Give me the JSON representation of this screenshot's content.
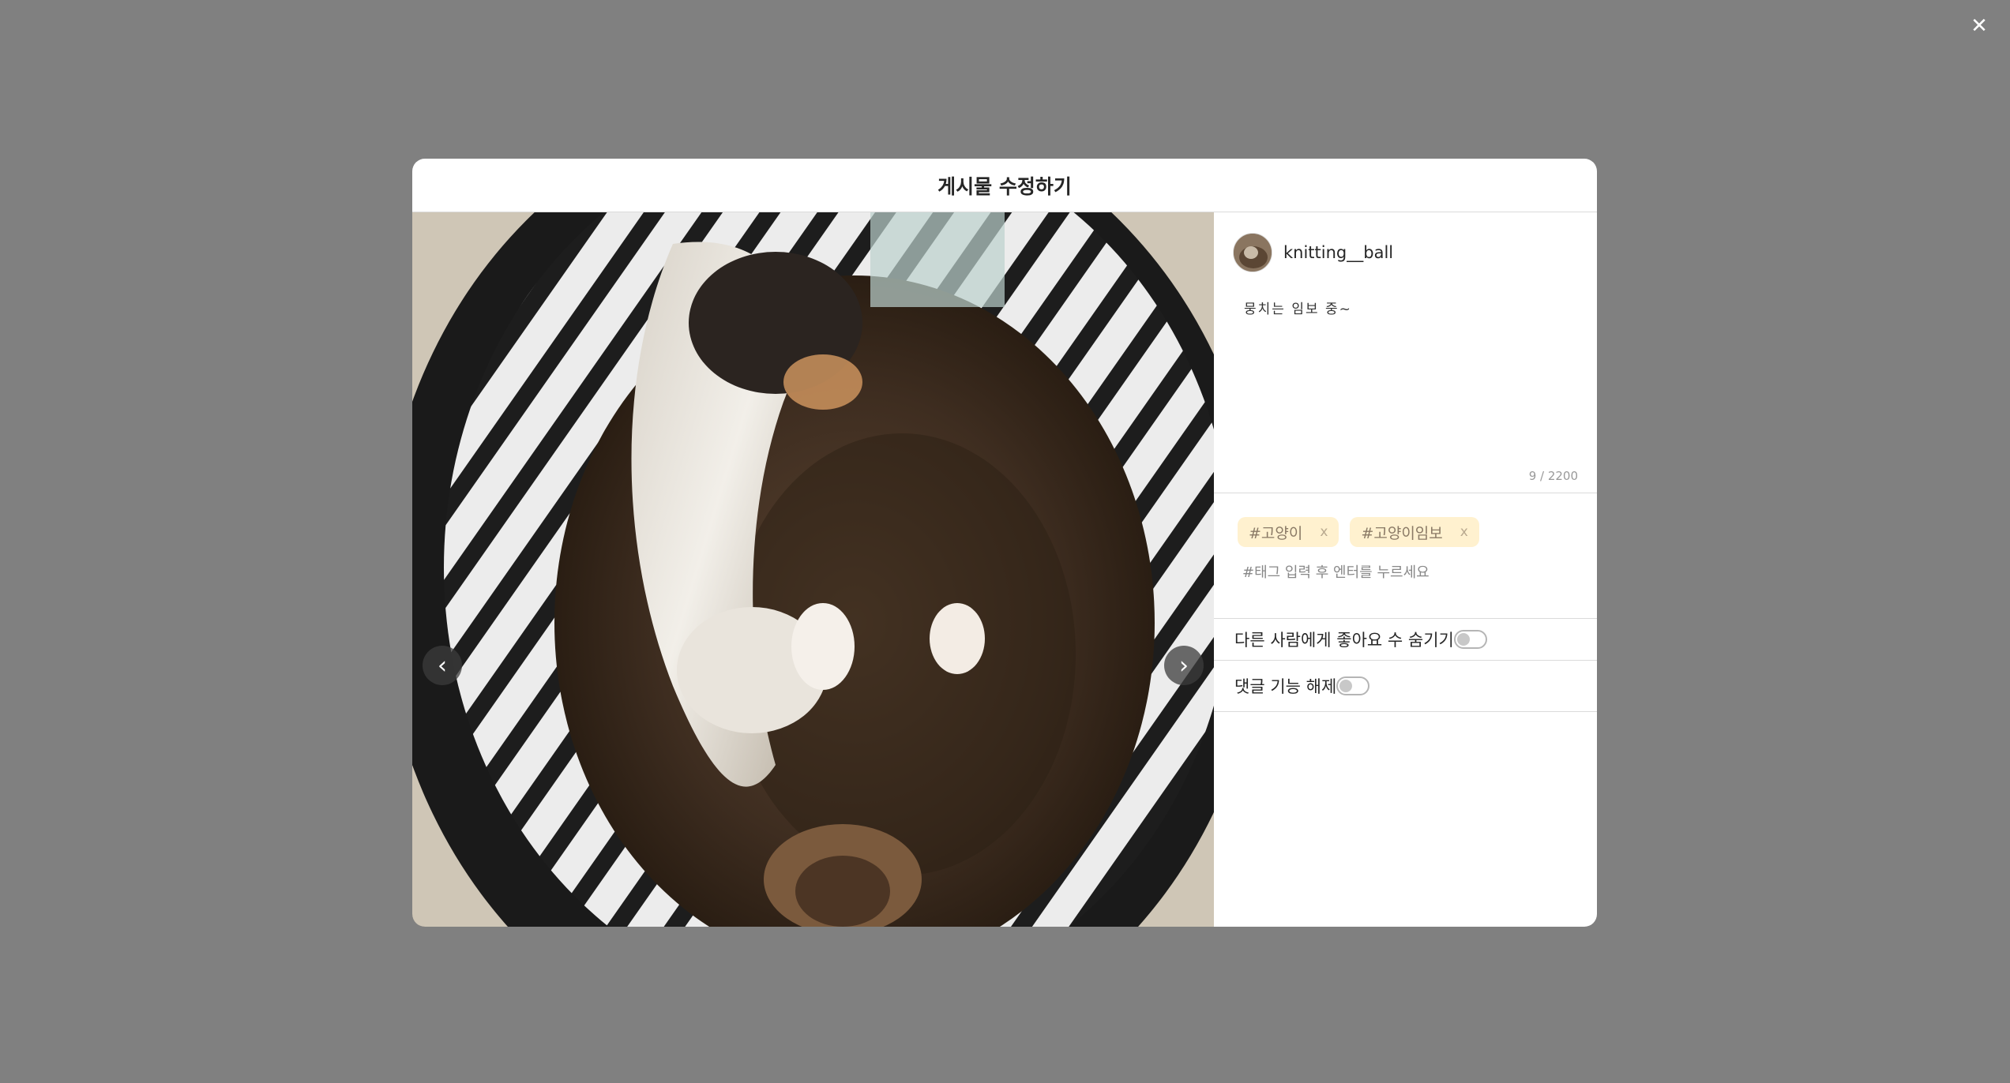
{
  "dialog": {
    "title": "게시물 수정하기",
    "close_glyph": "✕"
  },
  "photo": {
    "prev_glyph": "‹",
    "next_glyph": "›"
  },
  "post": {
    "username": "knitting__ball",
    "caption": "뭉치는 임보 중~",
    "char_count": "9 / 2200"
  },
  "tags": {
    "items": [
      {
        "label": "#고양이",
        "remove": "x"
      },
      {
        "label": "#고양이임보",
        "remove": "x"
      }
    ],
    "placeholder": "#태그 입력 후 엔터를 누르세요"
  },
  "options": {
    "hide_likes_label": "다른 사람에게 좋아요 수 숨기기",
    "hide_likes_on": false,
    "disable_comments_label": "댓글 기능 해제",
    "disable_comments_on": false
  }
}
